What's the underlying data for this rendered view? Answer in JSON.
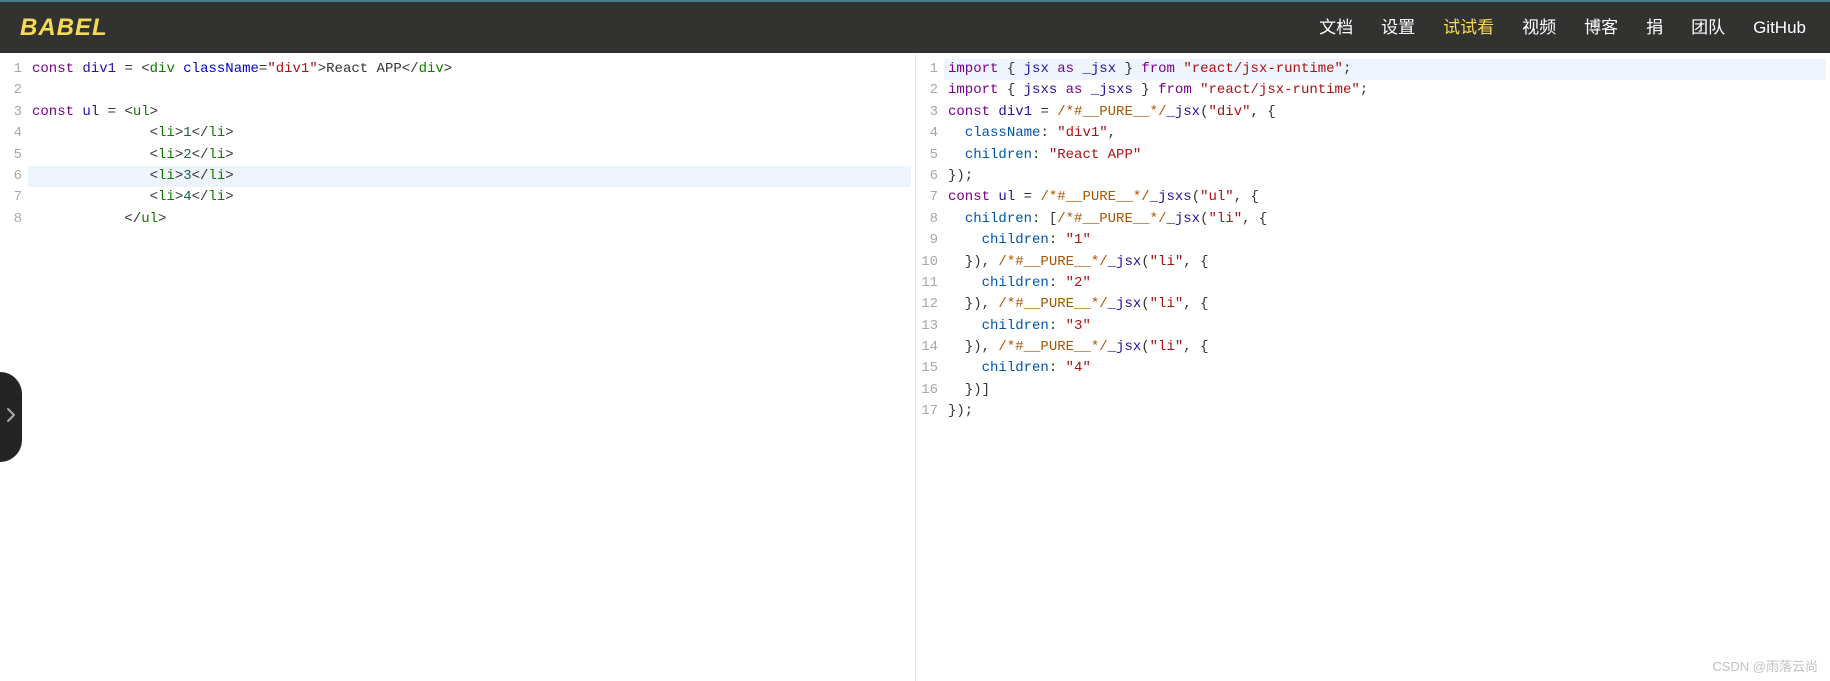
{
  "header": {
    "logo": "BABEL",
    "nav": [
      {
        "label": "文档",
        "active": false
      },
      {
        "label": "设置",
        "active": false
      },
      {
        "label": "试试看",
        "active": true
      },
      {
        "label": "视频",
        "active": false
      },
      {
        "label": "博客",
        "active": false
      },
      {
        "label": "捐",
        "active": false
      },
      {
        "label": "团队",
        "active": false
      },
      {
        "label": "GitHub",
        "active": false
      }
    ]
  },
  "leftEditor": {
    "highlightedLine": 6,
    "lineCount": 8,
    "lines": [
      {
        "n": 1,
        "tokens": [
          {
            "c": "kw",
            "t": "const"
          },
          {
            "t": " "
          },
          {
            "c": "kw2",
            "t": "div1"
          },
          {
            "t": " "
          },
          {
            "c": "pun",
            "t": "="
          },
          {
            "t": " "
          },
          {
            "c": "pun",
            "t": "<"
          },
          {
            "c": "tag",
            "t": "div"
          },
          {
            "t": " "
          },
          {
            "c": "attr",
            "t": "className"
          },
          {
            "c": "pun",
            "t": "="
          },
          {
            "c": "str",
            "t": "\"div1\""
          },
          {
            "c": "pun",
            "t": ">"
          },
          {
            "t": "React APP"
          },
          {
            "c": "pun",
            "t": "</"
          },
          {
            "c": "tag",
            "t": "div"
          },
          {
            "c": "pun",
            "t": ">"
          }
        ]
      },
      {
        "n": 2,
        "tokens": []
      },
      {
        "n": 3,
        "tokens": [
          {
            "c": "kw",
            "t": "const"
          },
          {
            "t": " "
          },
          {
            "c": "kw2",
            "t": "ul"
          },
          {
            "t": " "
          },
          {
            "c": "pun",
            "t": "="
          },
          {
            "t": " "
          },
          {
            "c": "pun",
            "t": "<"
          },
          {
            "c": "tag",
            "t": "ul"
          },
          {
            "c": "pun",
            "t": ">"
          }
        ]
      },
      {
        "n": 4,
        "tokens": [
          {
            "t": "              "
          },
          {
            "c": "pun",
            "t": "<"
          },
          {
            "c": "tag",
            "t": "li"
          },
          {
            "c": "pun",
            "t": ">"
          },
          {
            "c": "num",
            "t": "1"
          },
          {
            "c": "pun",
            "t": "</"
          },
          {
            "c": "tag",
            "t": "li"
          },
          {
            "c": "pun",
            "t": ">"
          }
        ]
      },
      {
        "n": 5,
        "tokens": [
          {
            "t": "              "
          },
          {
            "c": "pun",
            "t": "<"
          },
          {
            "c": "tag",
            "t": "li"
          },
          {
            "c": "pun",
            "t": ">"
          },
          {
            "c": "num",
            "t": "2"
          },
          {
            "c": "pun",
            "t": "</"
          },
          {
            "c": "tag",
            "t": "li"
          },
          {
            "c": "pun",
            "t": ">"
          }
        ]
      },
      {
        "n": 6,
        "tokens": [
          {
            "t": "              "
          },
          {
            "c": "pun",
            "t": "<"
          },
          {
            "c": "tag",
            "t": "li"
          },
          {
            "c": "pun",
            "t": ">"
          },
          {
            "c": "num",
            "t": "3"
          },
          {
            "c": "pun",
            "t": "</"
          },
          {
            "c": "tag",
            "t": "li"
          },
          {
            "c": "pun",
            "t": ">"
          }
        ]
      },
      {
        "n": 7,
        "tokens": [
          {
            "t": "              "
          },
          {
            "c": "pun",
            "t": "<"
          },
          {
            "c": "tag",
            "t": "li"
          },
          {
            "c": "pun",
            "t": ">"
          },
          {
            "c": "num",
            "t": "4"
          },
          {
            "c": "pun",
            "t": "</"
          },
          {
            "c": "tag",
            "t": "li"
          },
          {
            "c": "pun",
            "t": ">"
          }
        ]
      },
      {
        "n": 8,
        "tokens": [
          {
            "t": "           "
          },
          {
            "c": "pun",
            "t": "</"
          },
          {
            "c": "tag",
            "t": "ul"
          },
          {
            "c": "pun",
            "t": ">"
          }
        ]
      }
    ]
  },
  "rightEditor": {
    "highlightedLine": 1,
    "lineCount": 17,
    "lines": [
      {
        "n": 1,
        "tokens": [
          {
            "c": "kw",
            "t": "import"
          },
          {
            "t": " { "
          },
          {
            "c": "kw2",
            "t": "jsx"
          },
          {
            "t": " "
          },
          {
            "c": "kw",
            "t": "as"
          },
          {
            "t": " "
          },
          {
            "c": "kw2",
            "t": "_jsx"
          },
          {
            "t": " } "
          },
          {
            "c": "kw",
            "t": "from"
          },
          {
            "t": " "
          },
          {
            "c": "str",
            "t": "\"react/jsx-runtime\""
          },
          {
            "c": "pun",
            "t": ";"
          }
        ]
      },
      {
        "n": 2,
        "tokens": [
          {
            "c": "kw",
            "t": "import"
          },
          {
            "t": " { "
          },
          {
            "c": "kw2",
            "t": "jsxs"
          },
          {
            "t": " "
          },
          {
            "c": "kw",
            "t": "as"
          },
          {
            "t": " "
          },
          {
            "c": "kw2",
            "t": "_jsxs"
          },
          {
            "t": " } "
          },
          {
            "c": "kw",
            "t": "from"
          },
          {
            "t": " "
          },
          {
            "c": "str",
            "t": "\"react/jsx-runtime\""
          },
          {
            "c": "pun",
            "t": ";"
          }
        ]
      },
      {
        "n": 3,
        "tokens": [
          {
            "c": "kw",
            "t": "const"
          },
          {
            "t": " "
          },
          {
            "c": "kw2",
            "t": "div1"
          },
          {
            "t": " "
          },
          {
            "c": "pun",
            "t": "="
          },
          {
            "t": " "
          },
          {
            "c": "cmt",
            "t": "/*#__PURE__*/"
          },
          {
            "c": "kw2",
            "t": "_jsx"
          },
          {
            "c": "pun",
            "t": "("
          },
          {
            "c": "str",
            "t": "\"div\""
          },
          {
            "c": "pun",
            "t": ","
          },
          {
            "t": " {"
          }
        ]
      },
      {
        "n": 4,
        "tokens": [
          {
            "t": "  "
          },
          {
            "c": "prop",
            "t": "className"
          },
          {
            "c": "pun",
            "t": ":"
          },
          {
            "t": " "
          },
          {
            "c": "str",
            "t": "\"div1\""
          },
          {
            "c": "pun",
            "t": ","
          }
        ]
      },
      {
        "n": 5,
        "tokens": [
          {
            "t": "  "
          },
          {
            "c": "prop",
            "t": "children"
          },
          {
            "c": "pun",
            "t": ":"
          },
          {
            "t": " "
          },
          {
            "c": "str",
            "t": "\"React APP\""
          }
        ]
      },
      {
        "n": 6,
        "tokens": [
          {
            "c": "pun",
            "t": "});"
          }
        ]
      },
      {
        "n": 7,
        "tokens": [
          {
            "c": "kw",
            "t": "const"
          },
          {
            "t": " "
          },
          {
            "c": "kw2",
            "t": "ul"
          },
          {
            "t": " "
          },
          {
            "c": "pun",
            "t": "="
          },
          {
            "t": " "
          },
          {
            "c": "cmt",
            "t": "/*#__PURE__*/"
          },
          {
            "c": "kw2",
            "t": "_jsxs"
          },
          {
            "c": "pun",
            "t": "("
          },
          {
            "c": "str",
            "t": "\"ul\""
          },
          {
            "c": "pun",
            "t": ","
          },
          {
            "t": " {"
          }
        ]
      },
      {
        "n": 8,
        "tokens": [
          {
            "t": "  "
          },
          {
            "c": "prop",
            "t": "children"
          },
          {
            "c": "pun",
            "t": ":"
          },
          {
            "t": " ["
          },
          {
            "c": "cmt",
            "t": "/*#__PURE__*/"
          },
          {
            "c": "kw2",
            "t": "_jsx"
          },
          {
            "c": "pun",
            "t": "("
          },
          {
            "c": "str",
            "t": "\"li\""
          },
          {
            "c": "pun",
            "t": ","
          },
          {
            "t": " {"
          }
        ]
      },
      {
        "n": 9,
        "tokens": [
          {
            "t": "    "
          },
          {
            "c": "prop",
            "t": "children"
          },
          {
            "c": "pun",
            "t": ":"
          },
          {
            "t": " "
          },
          {
            "c": "str",
            "t": "\"1\""
          }
        ]
      },
      {
        "n": 10,
        "tokens": [
          {
            "t": "  }), "
          },
          {
            "c": "cmt",
            "t": "/*#__PURE__*/"
          },
          {
            "c": "kw2",
            "t": "_jsx"
          },
          {
            "c": "pun",
            "t": "("
          },
          {
            "c": "str",
            "t": "\"li\""
          },
          {
            "c": "pun",
            "t": ","
          },
          {
            "t": " {"
          }
        ]
      },
      {
        "n": 11,
        "tokens": [
          {
            "t": "    "
          },
          {
            "c": "prop",
            "t": "children"
          },
          {
            "c": "pun",
            "t": ":"
          },
          {
            "t": " "
          },
          {
            "c": "str",
            "t": "\"2\""
          }
        ]
      },
      {
        "n": 12,
        "tokens": [
          {
            "t": "  }), "
          },
          {
            "c": "cmt",
            "t": "/*#__PURE__*/"
          },
          {
            "c": "kw2",
            "t": "_jsx"
          },
          {
            "c": "pun",
            "t": "("
          },
          {
            "c": "str",
            "t": "\"li\""
          },
          {
            "c": "pun",
            "t": ","
          },
          {
            "t": " {"
          }
        ]
      },
      {
        "n": 13,
        "tokens": [
          {
            "t": "    "
          },
          {
            "c": "prop",
            "t": "children"
          },
          {
            "c": "pun",
            "t": ":"
          },
          {
            "t": " "
          },
          {
            "c": "str",
            "t": "\"3\""
          }
        ]
      },
      {
        "n": 14,
        "tokens": [
          {
            "t": "  }), "
          },
          {
            "c": "cmt",
            "t": "/*#__PURE__*/"
          },
          {
            "c": "kw2",
            "t": "_jsx"
          },
          {
            "c": "pun",
            "t": "("
          },
          {
            "c": "str",
            "t": "\"li\""
          },
          {
            "c": "pun",
            "t": ","
          },
          {
            "t": " {"
          }
        ]
      },
      {
        "n": 15,
        "tokens": [
          {
            "t": "    "
          },
          {
            "c": "prop",
            "t": "children"
          },
          {
            "c": "pun",
            "t": ":"
          },
          {
            "t": " "
          },
          {
            "c": "str",
            "t": "\"4\""
          }
        ]
      },
      {
        "n": 16,
        "tokens": [
          {
            "t": "  })]"
          }
        ]
      },
      {
        "n": 17,
        "tokens": [
          {
            "c": "pun",
            "t": "});"
          }
        ]
      }
    ]
  },
  "watermark": "CSDN @雨落云尚"
}
